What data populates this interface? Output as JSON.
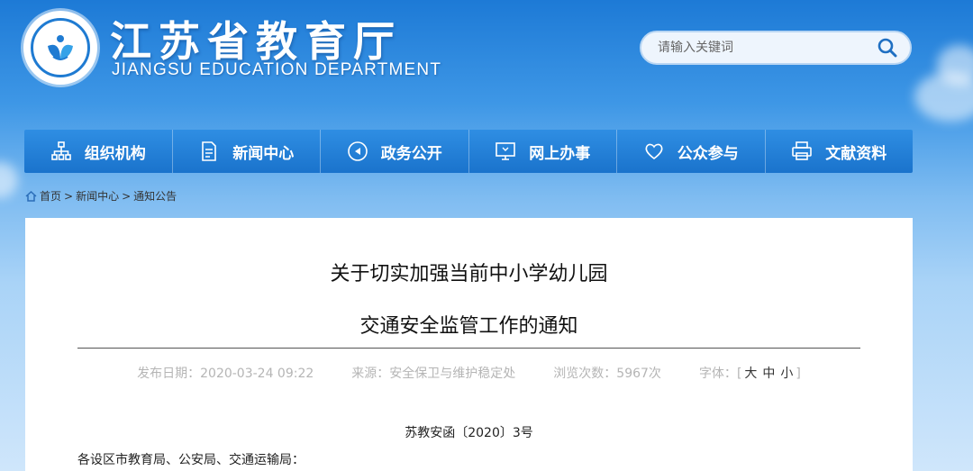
{
  "header": {
    "title": "江苏省教育厅",
    "subtitle": "JIANGSU EDUCATION DEPARTMENT"
  },
  "search": {
    "placeholder": "请输入关键词",
    "icon": "search-icon"
  },
  "nav": [
    {
      "label": "组织机构",
      "icon": "org-chart-icon"
    },
    {
      "label": "新闻中心",
      "icon": "document-icon"
    },
    {
      "label": "政务公开",
      "icon": "megaphone-icon"
    },
    {
      "label": "网上办事",
      "icon": "monitor-icon"
    },
    {
      "label": "公众参与",
      "icon": "heart-icon"
    },
    {
      "label": "文献资料",
      "icon": "printer-icon"
    }
  ],
  "breadcrumb": {
    "home": "首页",
    "sep1": ">",
    "news": "新闻中心",
    "sep2": ">",
    "current": "通知公告"
  },
  "article": {
    "title_line1": "关于切实加强当前中小学幼儿园",
    "title_line2": "交通安全监管工作的通知",
    "publish_date": "发布日期：2020-03-24 09:22",
    "source": "来源：安全保卫与维护稳定处",
    "views": "浏览次数：5967次",
    "font_size_label": "字体：",
    "font_open": "[",
    "font_large": "大",
    "font_medium": "中",
    "font_small": "小",
    "font_close": "]",
    "doc_number": "苏教安函〔2020〕3号",
    "recipients": "各设区市教育局、公安局、交通运输局："
  },
  "colors": {
    "nav_bg": "#1f7bd2",
    "brand_blue": "#1f7bd2"
  }
}
